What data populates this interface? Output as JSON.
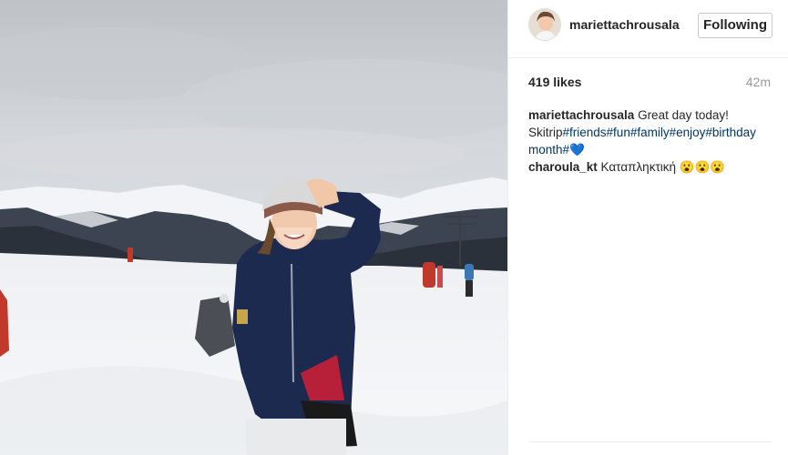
{
  "post": {
    "username": "mariettachrousala",
    "follow_label": "Following",
    "likes": "419 likes",
    "time": "42m"
  },
  "comments": [
    {
      "user": "mariettachrousala",
      "text_parts": [
        {
          "text": " Great day today! Skitrip",
          "type": "text"
        },
        {
          "text": "#friends",
          "type": "hashtag"
        },
        {
          "text": "#fun",
          "type": "hashtag"
        },
        {
          "text": "#family",
          "type": "hashtag"
        },
        {
          "text": "#enjoy",
          "type": "hashtag"
        },
        {
          "text": "#birthday month",
          "type": "hashtag"
        },
        {
          "text": "#",
          "type": "hashtag"
        },
        {
          "text": "💙",
          "type": "emoji"
        }
      ]
    },
    {
      "user": "charoula_kt",
      "text_parts": [
        {
          "text": " Καταπληκτική 😮😮😮",
          "type": "text"
        }
      ]
    }
  ],
  "colors": {
    "hashtag": "#003569",
    "muted": "#999999",
    "text": "#262626"
  }
}
